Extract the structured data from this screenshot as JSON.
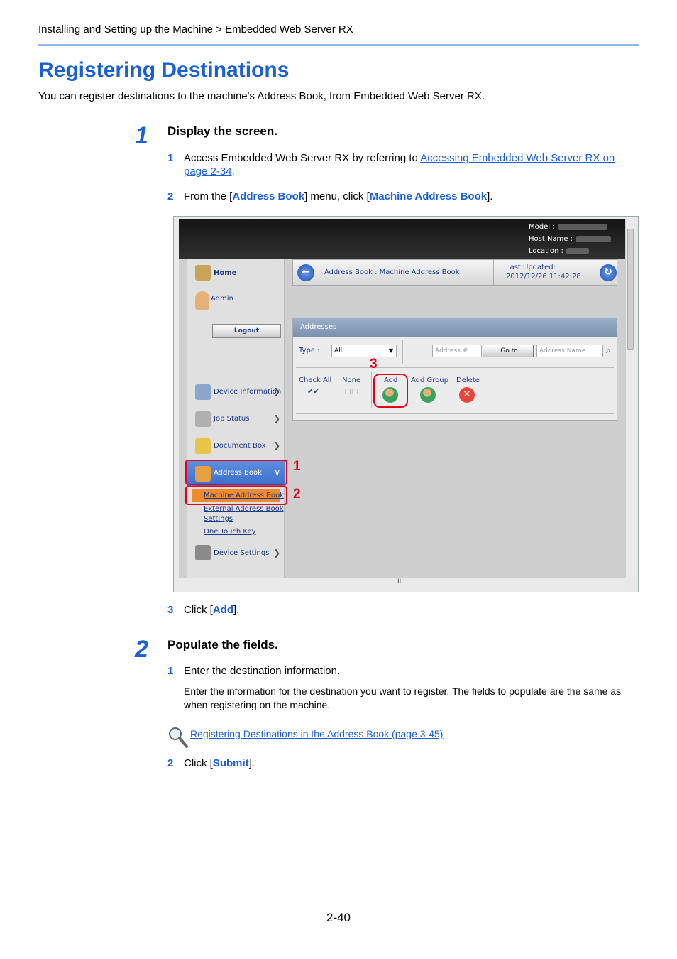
{
  "breadcrumb": "Installing and Setting up the Machine > Embedded Web Server RX",
  "title": "Registering Destinations",
  "intro": "You can register destinations to the machine's Address Book, from Embedded Web Server RX.",
  "step1": {
    "num": "1",
    "heading": "Display the screen.",
    "sub1": {
      "num": "1",
      "text": "Access Embedded Web Server RX by referring to ",
      "link_line1": "Accessing Embedded Web Server RX on ",
      "link_line2": "page 2-34",
      "end": "."
    },
    "sub2": {
      "num": "2",
      "pre": "From the [",
      "kw1": "Address Book",
      "mid": "] menu, click [",
      "kw2": "Machine Address Book",
      "end": "]."
    },
    "sub3": {
      "num": "3",
      "pre": "Click [",
      "kw": "Add",
      "end": "]."
    }
  },
  "step2": {
    "num": "2",
    "heading": "Populate the fields.",
    "sub1": {
      "num": "1",
      "text": "Enter the destination information.",
      "note": "Enter the information for the destination you want to register. The fields to populate are the same as when registering on the machine."
    },
    "ref_link": "Registering Destinations in the Address Book (page 3-45)",
    "sub2": {
      "num": "2",
      "pre": "Click [",
      "kw": "Submit",
      "end": "]."
    }
  },
  "page_number": "2-40",
  "screenshot": {
    "model_label": "Model :",
    "host_label": "Host Name :",
    "location_label": "Location :",
    "nav": {
      "home": "Home",
      "admin": "Admin",
      "logout": "Logout",
      "device_info": "Device Information",
      "job_status": "Job Status",
      "document_box": "Document Box",
      "address_book": "Address Book",
      "machine_address_book": "Machine Address Book",
      "external_address_book": "External Address Book",
      "settings": "Settings",
      "one_touch_key": "One Touch Key",
      "device_settings": "Device Settings"
    },
    "header_path": "Address Book : Machine Address Book",
    "last_updated_label": "Last Updated:",
    "last_updated_value": "2012/12/26 11:42:28",
    "panel_title": "Addresses",
    "type_label": "Type :",
    "type_value": "All",
    "address_num_placeholder": "Address #",
    "goto": "Go to",
    "address_name_placeholder": "Address Name",
    "check_all": "Check All",
    "none": "None",
    "add": "Add",
    "add_group": "Add Group",
    "delete": "Delete",
    "callouts": [
      "1",
      "2",
      "3"
    ],
    "hscroll_glyph": "III"
  }
}
